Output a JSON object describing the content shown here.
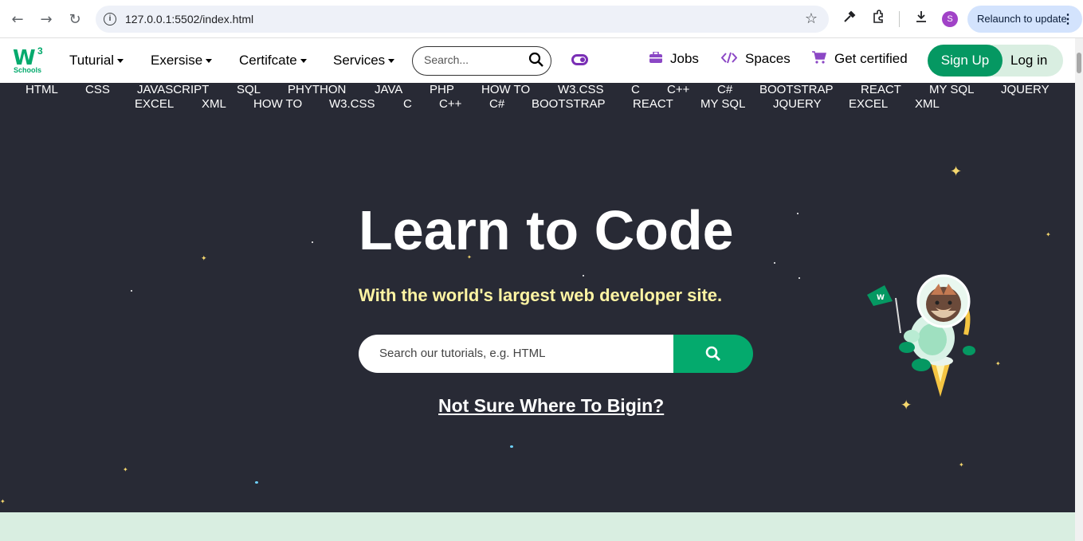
{
  "browser": {
    "url": "127.0.0.1:5502/index.html",
    "profile_initial": "S",
    "relaunch_label": "Relaunch to update"
  },
  "navbar": {
    "logo_text": "W",
    "logo_sup": "3",
    "logo_sub": "Schools",
    "menus": [
      "Tuturial",
      "Exersise",
      "Certifcate",
      "Services"
    ],
    "search_placeholder": "Search...",
    "links": {
      "jobs": "Jobs",
      "spaces": "Spaces",
      "certified": "Get certified"
    },
    "signup": "Sign Up",
    "login": "Log in"
  },
  "topics_row1": [
    "HTML",
    "CSS",
    "JAVASCRIPT",
    "SQL",
    "PHYTHON",
    "JAVA",
    "PHP",
    "HOW TO",
    "W3.CSS",
    "C",
    "C++",
    "C#",
    "BOOTSTRAP",
    "REACT",
    "MY SQL",
    "JQUERY"
  ],
  "topics_row2": [
    "EXCEL",
    "XML",
    "HOW TO",
    "W3.CSS",
    "C",
    "C++",
    "C#",
    "BOOTSTRAP",
    "REACT",
    "MY SQL",
    "JQUERY",
    "EXCEL",
    "XML"
  ],
  "hero": {
    "title": "Learn to Code",
    "subtitle": "With the world's largest web developer site.",
    "search_placeholder": "Search our tutorials, e.g. HTML",
    "cta": "Not Sure Where To Bigin?"
  },
  "colors": {
    "brand_green": "#04aa6d",
    "hero_bg": "#282a35",
    "subtitle_yellow": "#fff4a3",
    "band_green": "#d9eee1"
  }
}
